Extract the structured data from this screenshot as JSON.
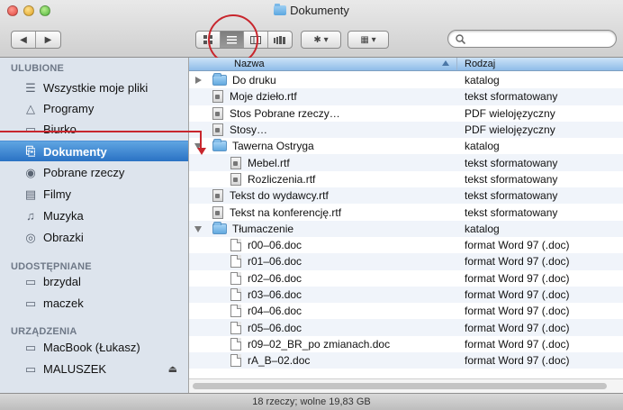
{
  "window": {
    "title": "Dokumenty"
  },
  "toolbar": {
    "back_icon": "◀",
    "forward_icon": "▶",
    "view_modes": [
      "icon-view-icon",
      "list-view-icon",
      "column-view-icon",
      "coverflow-view-icon"
    ],
    "active_view": "list",
    "action_label": "✱ ▾",
    "arrange_label": "▦ ▾",
    "search_placeholder": ""
  },
  "sidebar": {
    "sections": [
      {
        "heading": "ULUBIONE"
      },
      {
        "heading": "UDOSTĘPNIANE"
      },
      {
        "heading": "URZĄDZENIA"
      }
    ],
    "items": [
      {
        "label": "Wszystkie moje pliki",
        "icon": "all-files-icon",
        "glyph": "☰"
      },
      {
        "label": "Programy",
        "icon": "applications-icon",
        "glyph": "△"
      },
      {
        "label": "Biurko",
        "icon": "desktop-icon",
        "glyph": "▭"
      },
      {
        "label": "Dokumenty",
        "icon": "documents-icon",
        "glyph": "⎘",
        "selected": true
      },
      {
        "label": "Pobrane rzeczy",
        "icon": "downloads-icon",
        "glyph": "◉"
      },
      {
        "label": "Filmy",
        "icon": "movies-icon",
        "glyph": "▤"
      },
      {
        "label": "Muzyka",
        "icon": "music-icon",
        "glyph": "♫"
      },
      {
        "label": "Obrazki",
        "icon": "pictures-icon",
        "glyph": "◎"
      },
      {
        "label": "brzydal",
        "icon": "computer-icon",
        "glyph": "▭"
      },
      {
        "label": "maczek",
        "icon": "computer-icon",
        "glyph": "▭"
      },
      {
        "label": "MacBook (Łukasz)",
        "icon": "laptop-icon",
        "glyph": "▭"
      },
      {
        "label": "MALUSZEK",
        "icon": "drive-icon",
        "glyph": "▭",
        "eject": "⏏"
      }
    ]
  },
  "list": {
    "columns": {
      "name": "Nazwa",
      "kind": "Rodzaj"
    },
    "rows": [
      {
        "name": "Do druku",
        "kind": "katalog",
        "type": "folder",
        "disclosure": "closed",
        "level": 0
      },
      {
        "name": "Moje dzieło.rtf",
        "kind": "tekst sformatowany",
        "type": "rtf",
        "level": 0
      },
      {
        "name": "Stos Pobrane rzeczy…",
        "kind": "PDF wielojęzyczny",
        "type": "rtf",
        "level": 0
      },
      {
        "name": "Stosy…",
        "kind": "PDF wielojęzyczny",
        "type": "rtf",
        "level": 0
      },
      {
        "name": "Tawerna Ostryga",
        "kind": "katalog",
        "type": "folder",
        "disclosure": "open",
        "level": 0
      },
      {
        "name": "Mebel.rtf",
        "kind": "tekst sformatowany",
        "type": "rtf",
        "level": 1
      },
      {
        "name": "Rozliczenia.rtf",
        "kind": "tekst sformatowany",
        "type": "rtf",
        "level": 1
      },
      {
        "name": "Tekst do wydawcy.rtf",
        "kind": "tekst sformatowany",
        "type": "rtf",
        "level": 0
      },
      {
        "name": "Tekst na konferencję.rtf",
        "kind": "tekst sformatowany",
        "type": "rtf",
        "level": 0
      },
      {
        "name": "Tłumaczenie",
        "kind": "katalog",
        "type": "folder",
        "disclosure": "open",
        "level": 0
      },
      {
        "name": "r00–06.doc",
        "kind": "format Word 97 (.doc)",
        "type": "doc",
        "level": 1
      },
      {
        "name": "r01–06.doc",
        "kind": "format Word 97 (.doc)",
        "type": "doc",
        "level": 1
      },
      {
        "name": "r02–06.doc",
        "kind": "format Word 97 (.doc)",
        "type": "doc",
        "level": 1
      },
      {
        "name": "r03–06.doc",
        "kind": "format Word 97 (.doc)",
        "type": "doc",
        "level": 1
      },
      {
        "name": "r04–06.doc",
        "kind": "format Word 97 (.doc)",
        "type": "doc",
        "level": 1
      },
      {
        "name": "r05–06.doc",
        "kind": "format Word 97 (.doc)",
        "type": "doc",
        "level": 1
      },
      {
        "name": "r09–02_BR_po zmianach.doc",
        "kind": "format Word 97 (.doc)",
        "type": "doc",
        "level": 1
      },
      {
        "name": "rA_B–02.doc",
        "kind": "format Word 97 (.doc)",
        "type": "doc",
        "level": 1
      }
    ]
  },
  "status": {
    "text": "18 rzeczy; wolne 19,83 GB"
  },
  "colors": {
    "selection": "#2a72c4",
    "annotation": "#c8262d",
    "sidebar_bg": "#dde4ed"
  }
}
